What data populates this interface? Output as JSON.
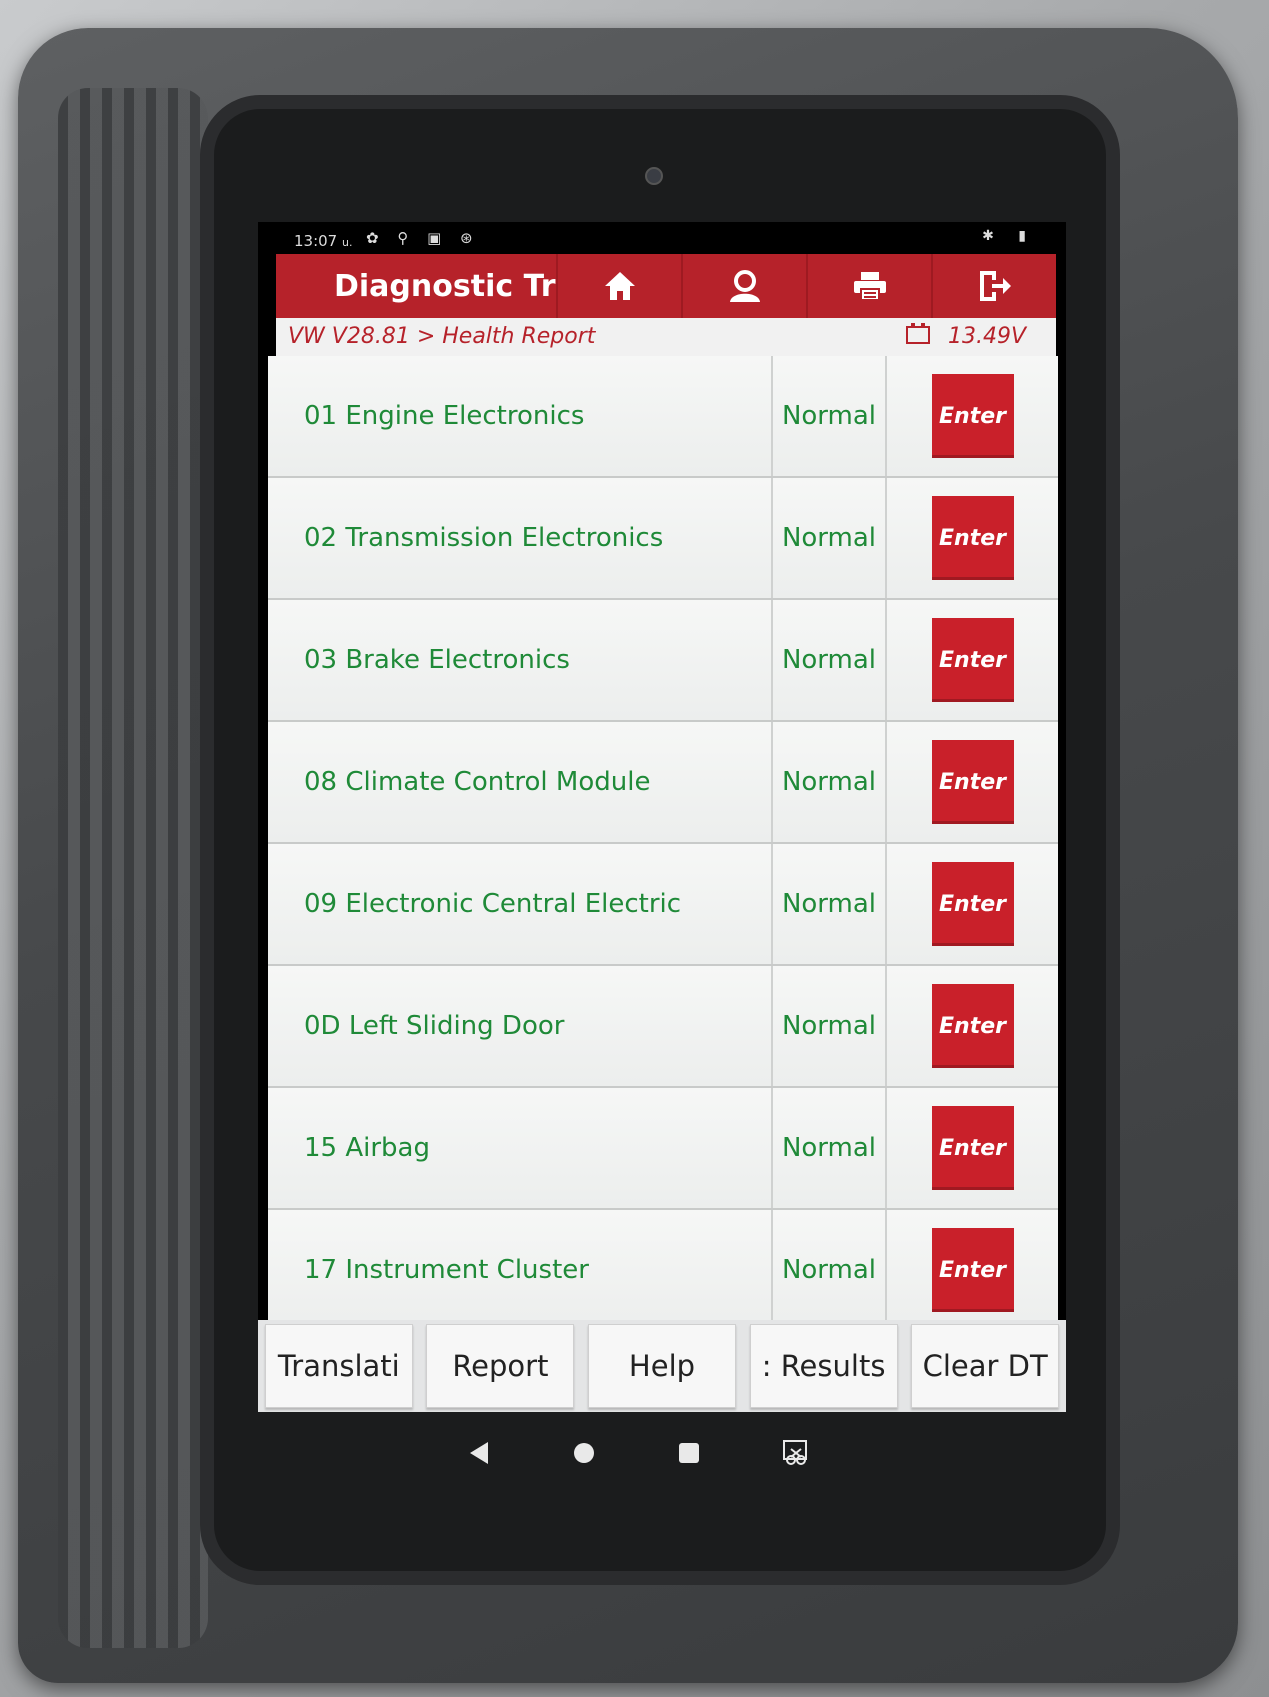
{
  "status_bar": {
    "time": "13:07",
    "time_suffix": "u.",
    "left_icons": "✿ ⚲ ▣ ⊛",
    "right_icons": "✱ ▮"
  },
  "app": {
    "title": "Diagnostic Tr",
    "accent": "#b6222a"
  },
  "toolbar": {
    "icons": [
      "home-icon",
      "user-icon",
      "print-icon",
      "exit-icon"
    ]
  },
  "breadcrumb": {
    "path": "VW V28.81 > Health Report",
    "voltage": "13.49V"
  },
  "systems": [
    {
      "name": "01 Engine Electronics",
      "status": "Normal",
      "action": "Enter"
    },
    {
      "name": "02 Transmission Electronics",
      "status": "Normal",
      "action": "Enter"
    },
    {
      "name": "03 Brake Electronics",
      "status": "Normal",
      "action": "Enter"
    },
    {
      "name": "08 Climate Control Module",
      "status": "Normal",
      "action": "Enter"
    },
    {
      "name": "09 Electronic Central Electric",
      "status": "Normal",
      "action": "Enter"
    },
    {
      "name": "0D Left Sliding Door",
      "status": "Normal",
      "action": "Enter"
    },
    {
      "name": "15 Airbag",
      "status": "Normal",
      "action": "Enter"
    },
    {
      "name": "17 Instrument Cluster",
      "status": "Normal",
      "action": "Enter"
    }
  ],
  "bottom_buttons": {
    "translation": "Translati",
    "report": "Report",
    "help": "Help",
    "results": ": Results",
    "clear_dtc": "Clear DT"
  },
  "nav": {
    "icons": [
      "back-icon",
      "home-circle-icon",
      "recents-icon",
      "screenshot-icon"
    ]
  }
}
